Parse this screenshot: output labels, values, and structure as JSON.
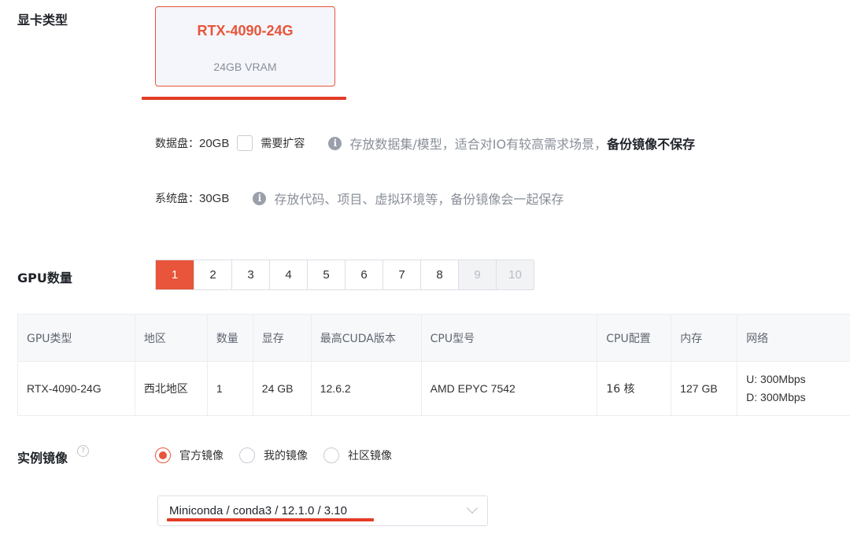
{
  "gpu_type": {
    "label": "显卡类型",
    "selected": {
      "name": "RTX-4090-24G",
      "vram": "24GB VRAM"
    }
  },
  "data_disk": {
    "label": "数据盘：",
    "size": "20GB",
    "expand_label": "需要扩容",
    "expand_checked": false,
    "hint": "存放数据集/模型，适合对IO有较高需求场景，",
    "hint_strong": "备份镜像不保存"
  },
  "system_disk": {
    "label": "系统盘：",
    "size": "30GB",
    "hint": "存放代码、项目、虚拟环境等，备份镜像会一起保存"
  },
  "gpu_count": {
    "label": "GPU数量",
    "options": [
      "1",
      "2",
      "3",
      "4",
      "5",
      "6",
      "7",
      "8",
      "9",
      "10"
    ],
    "selected": "1",
    "disabled": [
      "9",
      "10"
    ]
  },
  "spec_table": {
    "headers": [
      "GPU类型",
      "地区",
      "数量",
      "显存",
      "最高CUDA版本",
      "CPU型号",
      "CPU配置",
      "内存",
      "网络"
    ],
    "row": {
      "gpu_type": "RTX-4090-24G",
      "region": "西北地区",
      "count": "1",
      "vram": "24 GB",
      "cuda": "12.6.2",
      "cpu_model": "AMD EPYC 7542",
      "cpu_config": "16 核",
      "memory": "127 GB",
      "net_up": "U: 300Mbps",
      "net_down": "D: 300Mbps"
    }
  },
  "instance_image": {
    "label": "实例镜像",
    "help_icon": "question-circle-icon",
    "options": [
      "官方镜像",
      "我的镜像",
      "社区镜像"
    ],
    "selected": "官方镜像",
    "select_value": "Miniconda / conda3 / 12.1.0 / 3.10"
  },
  "colors": {
    "accent": "#e8553a",
    "annotation": "#e43b26"
  },
  "icons": {
    "info": "info-circle-icon",
    "chevron": "chevron-down-icon"
  }
}
